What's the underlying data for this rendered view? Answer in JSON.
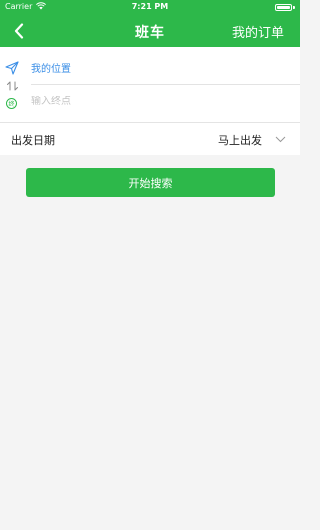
{
  "status_bar": {
    "carrier": "Carrier",
    "time": "7:21 PM"
  },
  "nav": {
    "title": "班车",
    "orders": "我的订单"
  },
  "route": {
    "from": "我的位置",
    "to_placeholder": "输入终点",
    "to_icon_text": "终"
  },
  "date": {
    "label": "出发日期",
    "value": "马上出发"
  },
  "search": {
    "label": "开始搜索"
  },
  "colors": {
    "primary": "#2db84a",
    "link_blue": "#3a8ee6",
    "placeholder": "#c4c4c4",
    "background": "#f4f4f4"
  }
}
